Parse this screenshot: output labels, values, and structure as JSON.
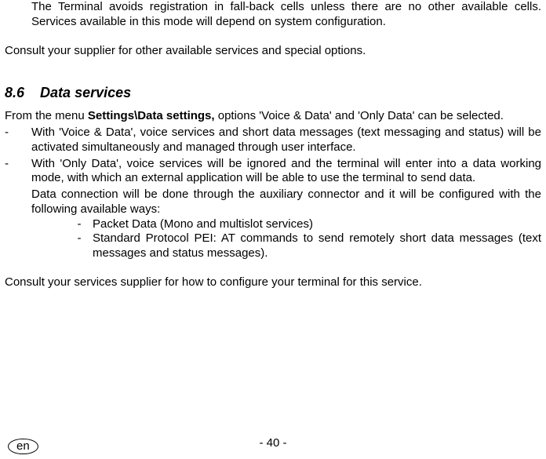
{
  "para1": "The Terminal avoids registration in fall-back cells unless there are no other available cells. Services available in this mode will depend on system configuration.",
  "para2": "Consult your supplier for other available services and special options.",
  "section_number": "8.6",
  "section_title": "Data services",
  "intro_part1": "From the menu ",
  "intro_bold": "Settings\\Data settings,",
  "intro_part2": " options 'Voice & Data' and 'Only Data' can be selected.",
  "item1": "With 'Voice & Data', voice services and short data messages (text messaging and status) will be activated simultaneously and managed through user interface.",
  "item2": "With 'Only Data', voice services will be ignored and the terminal will enter into a data working mode, with which an external application will be able to use the terminal to send data.",
  "item2_cont": "Data connection will be done through the auxiliary connector and it will be configured with the following available ways:",
  "sub1": "Packet Data (Mono and multislot services)",
  "sub2": "Standard Protocol PEI: AT commands to send remotely short data messages (text messages and status messages).",
  "closing": "Consult your services supplier for how to configure your terminal for this service.",
  "page_number": "- 40 -",
  "lang": "en",
  "dash": "-"
}
